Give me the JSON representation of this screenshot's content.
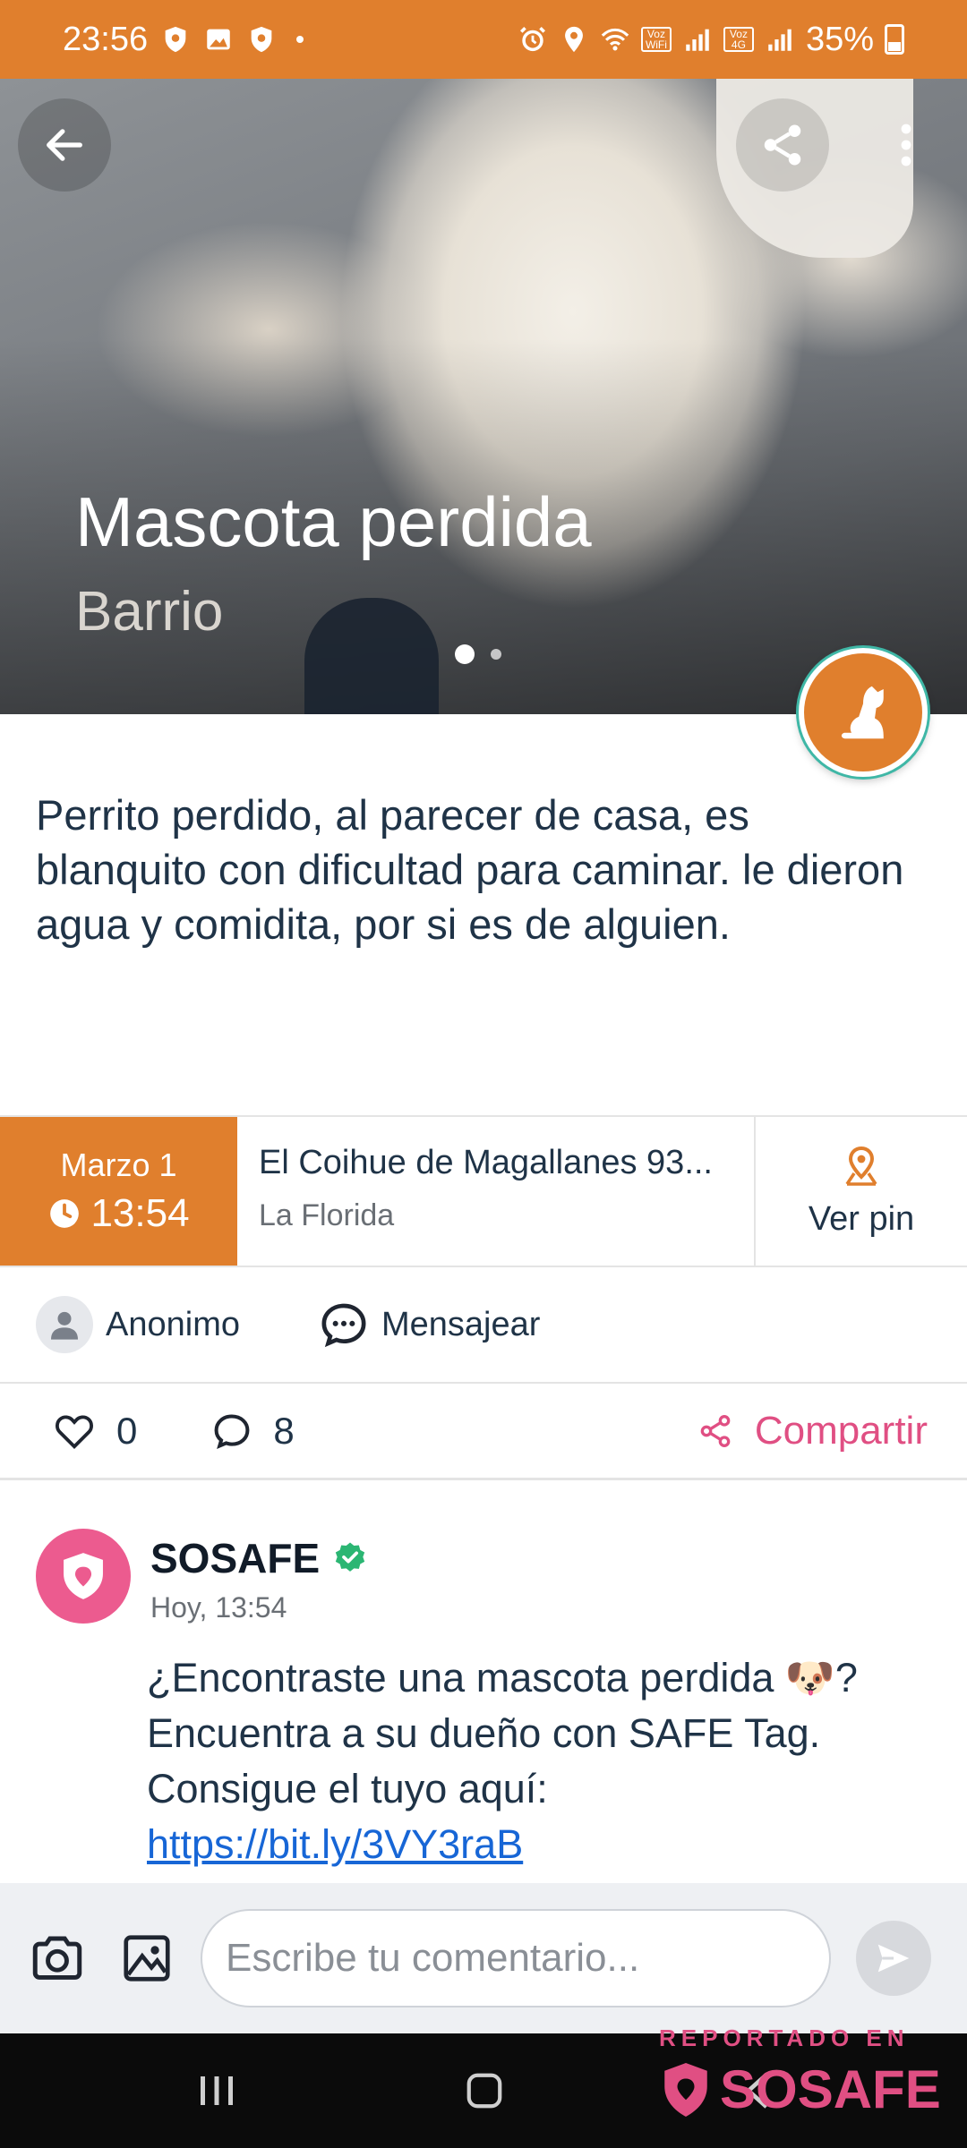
{
  "status_bar": {
    "time": "23:56",
    "battery": "35%",
    "voz_wifi": "Voz WiFi",
    "voz_4g": "Voz 4G"
  },
  "hero": {
    "title": "Mascota perdida",
    "subtitle": "Barrio"
  },
  "post": {
    "description": "Perrito perdido, al parecer de casa, es blanquito con dificultad para caminar. le dieron agua y comidita, por si es de alguien."
  },
  "info": {
    "date_month": "Marzo 1",
    "time": "13:54",
    "address": "El Coihue de Magallanes   93...",
    "city": "La Florida",
    "pin_label": "Ver pin"
  },
  "author": {
    "name": "Anonimo",
    "message_label": "Mensajear"
  },
  "actions": {
    "likes": "0",
    "comments": "8",
    "share_label": "Compartir"
  },
  "comment": {
    "author": "SOSAFE",
    "time": "Hoy, 13:54",
    "text": "¿Encontraste una mascota perdida 🐶? Encuentra a su dueño con SAFE Tag. Consigue el tuyo aquí:",
    "link": "https://bit.ly/3VY3raB"
  },
  "input": {
    "placeholder": "Escribe tu comentario..."
  },
  "watermark": {
    "label": "REPORTADO EN",
    "brand": "SOSAFE"
  },
  "colors": {
    "accent": "#e07f2d",
    "pink": "#e04f83",
    "link": "#1766d6",
    "verified": "#2bb673"
  }
}
